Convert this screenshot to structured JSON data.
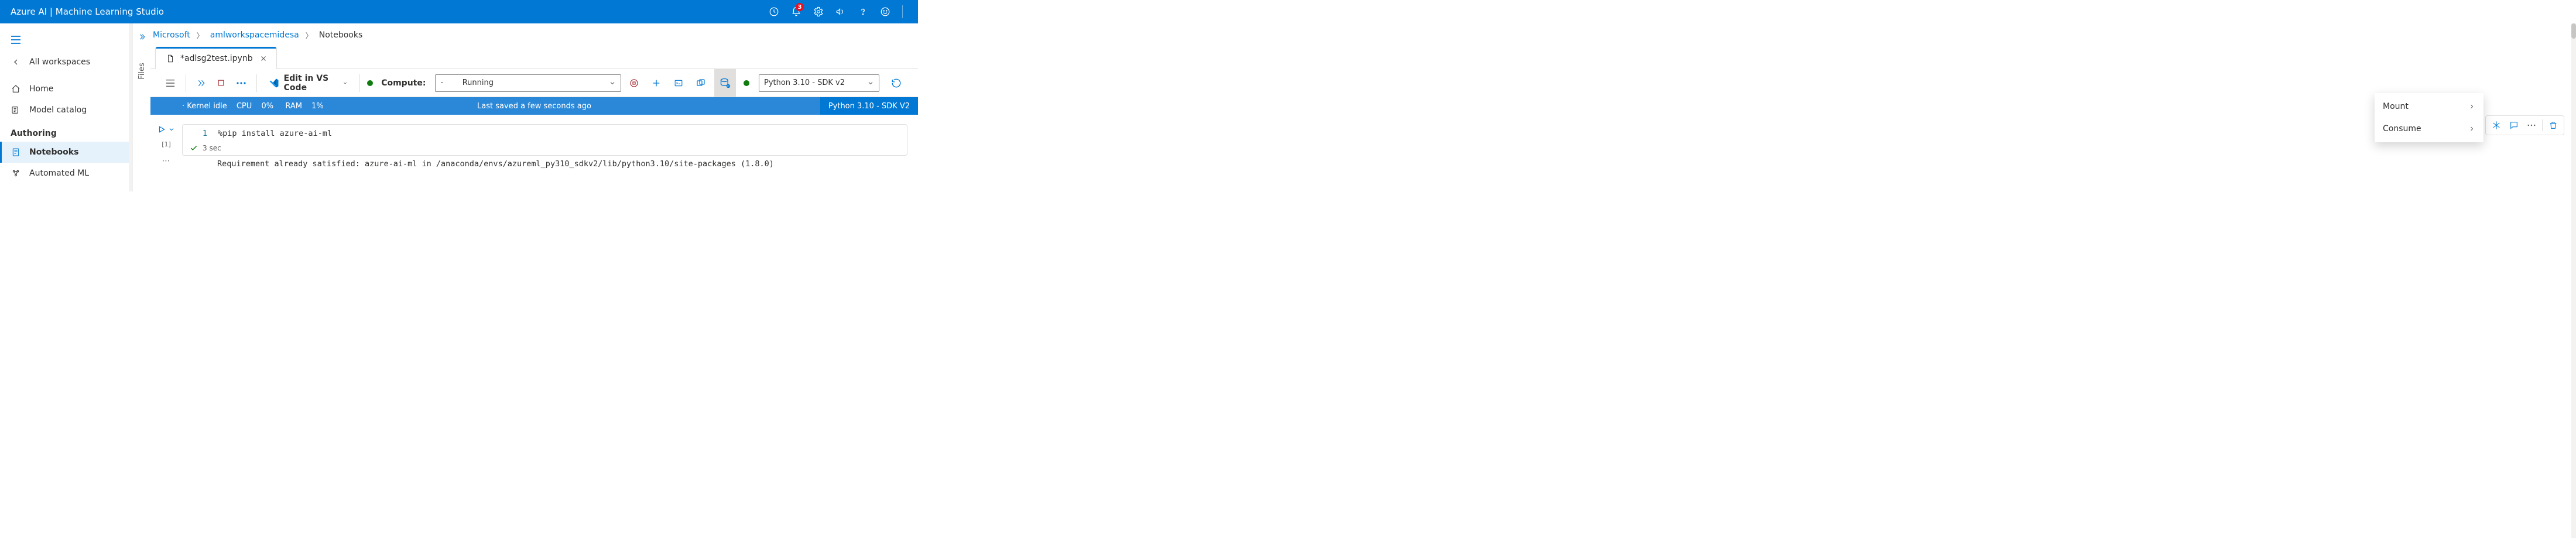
{
  "header": {
    "brand": "Azure AI | Machine Learning Studio",
    "notif_count": "3"
  },
  "nav": {
    "all_workspaces": "All workspaces",
    "home": "Home",
    "model_catalog": "Model catalog",
    "authoring_section": "Authoring",
    "notebooks": "Notebooks",
    "automated_ml": "Automated ML"
  },
  "breadcrumb": {
    "org": "Microsoft",
    "ws": "amlworkspacemidesa",
    "page": "Notebooks"
  },
  "tab": {
    "filename": "*adlsg2test.ipynb"
  },
  "files_label": "Files",
  "toolbar": {
    "vscode": "Edit in VS Code",
    "compute_label": "Compute:",
    "compute_hyphen": "-",
    "compute_state": "Running",
    "kernel": "Python 3.10 - SDK v2"
  },
  "status": {
    "kernel": "· Kernel idle",
    "cpu_l": "CPU",
    "cpu_v": "0%",
    "ram_l": "RAM",
    "ram_v": "1%",
    "saved": "Last saved a few seconds ago",
    "right": "Python 3.10 - SDK V2"
  },
  "dropdown": {
    "mount": "Mount",
    "consume": "Consume"
  },
  "cell": {
    "line_no": "1",
    "code": "%pip install azure-ai-ml",
    "exec_count": "[1]",
    "duration": "3 sec",
    "output": "Requirement already satisfied: azure-ai-ml in /anaconda/envs/azureml_py310_sdkv2/lib/python3.10/site-packages (1.8.0)"
  }
}
